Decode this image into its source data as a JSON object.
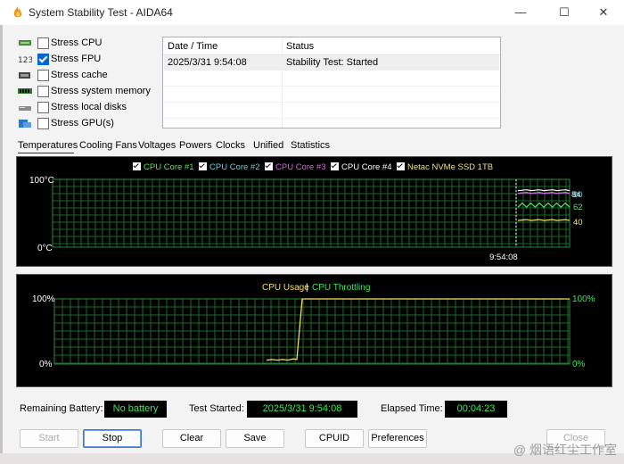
{
  "window": {
    "title": "System Stability Test - AIDA64",
    "minimize": "—",
    "maximize": "☐",
    "close": "✕"
  },
  "options": [
    {
      "label": "Stress CPU",
      "checked": false,
      "icon": "cpu-icon"
    },
    {
      "label": "Stress FPU",
      "checked": true,
      "icon": "fpu-icon"
    },
    {
      "label": "Stress cache",
      "checked": false,
      "icon": "cache-icon"
    },
    {
      "label": "Stress system memory",
      "checked": false,
      "icon": "memory-icon"
    },
    {
      "label": "Stress local disks",
      "checked": false,
      "icon": "disk-icon"
    },
    {
      "label": "Stress GPU(s)",
      "checked": false,
      "icon": "gpu-icon"
    }
  ],
  "log": {
    "columns": [
      "Date / Time",
      "Status"
    ],
    "rows": [
      {
        "datetime": "2025/3/31 9:54:08",
        "status": "Stability Test: Started"
      }
    ]
  },
  "tabs": [
    "Temperatures",
    "Cooling Fans",
    "Voltages",
    "Powers",
    "Clocks",
    "Unified",
    "Statistics"
  ],
  "active_tab": "Temperatures",
  "temp_chart": {
    "legend": [
      {
        "name": "CPU Core #1",
        "color": "#58e85c"
      },
      {
        "name": "CPU Core #2",
        "color": "#58d8e8"
      },
      {
        "name": "CPU Core #3",
        "color": "#e060e8"
      },
      {
        "name": "CPU Core #4",
        "color": "#ffffff"
      },
      {
        "name": "Netac NVMe SSD 1TB",
        "color": "#f0e080"
      }
    ],
    "y_top": "100°C",
    "y_bottom": "0°C",
    "time_label": "9:54:08",
    "right_labels": [
      {
        "text": "84",
        "color": "#58d8e8"
      },
      {
        "text": "80",
        "color": "#58d8e8"
      },
      {
        "text": "62",
        "color": "#58e85c"
      },
      {
        "text": "40",
        "color": "#f0e080"
      }
    ]
  },
  "usage_chart": {
    "title_usage": "CPU Usage",
    "title_sep": "|",
    "title_throttle": "CPU Throttling",
    "usage_color": "#f0e060",
    "throttle_color": "#3ee85a",
    "y_top_left": "100%",
    "y_bottom_left": "0%",
    "y_top_right": "100%",
    "y_bottom_right": "0%"
  },
  "chart_data": [
    {
      "type": "line",
      "title": "",
      "ylabel": "",
      "ylim": [
        0,
        100
      ],
      "x": [
        "9:54:08"
      ],
      "series": [
        {
          "name": "CPU Core #1",
          "values": [
            62
          ]
        },
        {
          "name": "CPU Core #2",
          "values": [
            80
          ]
        },
        {
          "name": "CPU Core #3",
          "values": [
            80
          ]
        },
        {
          "name": "CPU Core #4",
          "values": [
            84
          ]
        },
        {
          "name": "Netac NVMe SSD 1TB",
          "values": [
            40
          ]
        }
      ],
      "grid": true,
      "legend": "top"
    },
    {
      "type": "line",
      "title": "",
      "ylim": [
        0,
        100
      ],
      "series": [
        {
          "name": "CPU Usage",
          "values": [
            6,
            7,
            6,
            7,
            6,
            8,
            7,
            100,
            100,
            100,
            100,
            100
          ]
        },
        {
          "name": "CPU Throttling",
          "values": [
            0
          ]
        }
      ],
      "grid": true,
      "legend": "top"
    }
  ],
  "status_bar": {
    "battery_label": "Remaining Battery:",
    "battery_value": "No battery",
    "started_label": "Test Started:",
    "started_value": "2025/3/31 9:54:08",
    "elapsed_label": "Elapsed Time:",
    "elapsed_value": "00:04:23"
  },
  "buttons": {
    "start": "Start",
    "stop": "Stop",
    "clear": "Clear",
    "save": "Save",
    "cpuid": "CPUID",
    "preferences": "Preferences",
    "close": "Close"
  },
  "watermark": "@ 烟语红尘工作室"
}
